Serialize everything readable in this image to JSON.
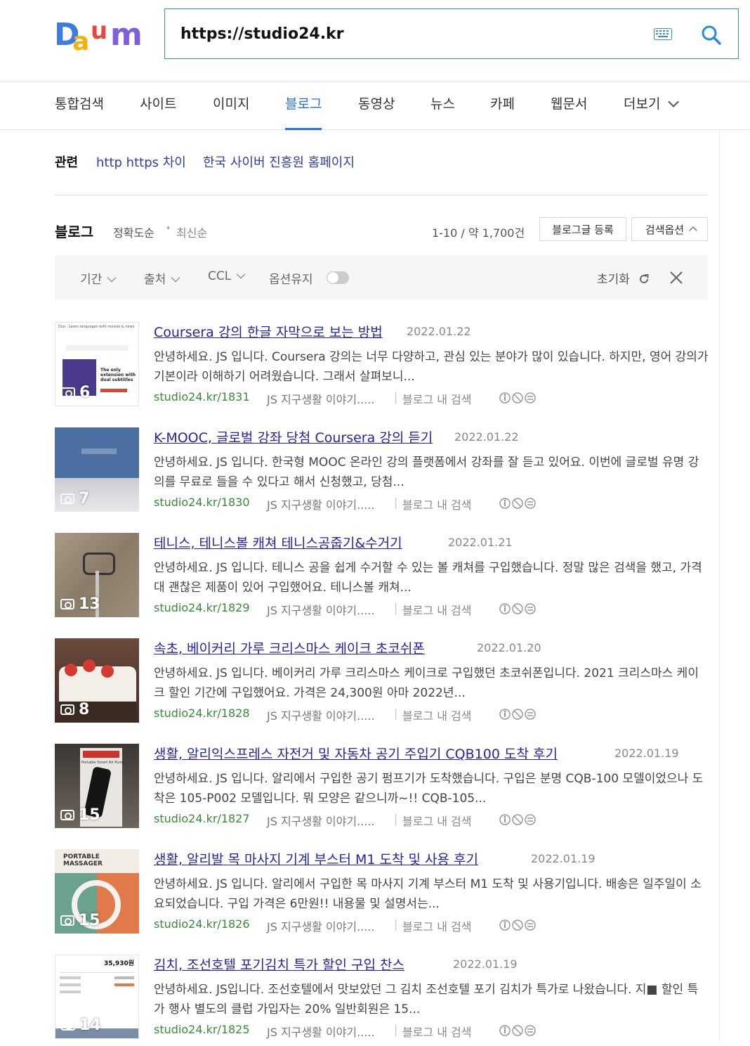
{
  "search": {
    "query": "https://studio24.kr"
  },
  "tabs": [
    "통합검색",
    "사이트",
    "이미지",
    "블로그",
    "동영상",
    "뉴스",
    "카페",
    "웹문서",
    "더보기"
  ],
  "related": {
    "label": "관련",
    "links": [
      "http https 차이",
      "한국 사이버 진흥원 홈페이지"
    ]
  },
  "blog_section": {
    "title": "블로그",
    "sort_accuracy": "정확도순",
    "sort_recent": "최신순",
    "count": "1-10 / 약 1,700건",
    "register_button": "블로그글 등록",
    "options_button": "검색옵션"
  },
  "filters": {
    "period": "기간",
    "source": "출처",
    "ccl": "CCL",
    "keep": "옵션유지",
    "reset": "초기화"
  },
  "results": [
    {
      "title": "Coursera 강의 한글 자막으로 보는 방법",
      "date": "2022.01.22",
      "desc": "안녕하세요. JS 입니다. Coursera 강의는 너무 다양하고, 관심 있는 분야가 많이 있습니다. 하지만, 영어 강의가 기본이라 이해하기 어려웠습니다. 그래서 살펴보니...",
      "url": "studio24.kr/1831",
      "source": "JS 지구생활 이야기.....",
      "blog_search": "블로그 내 검색",
      "photos": "6"
    },
    {
      "title": "K-MOOC, 글로벌 강좌 당첨 Coursera 강의 듣기",
      "date": "2022.01.22",
      "desc": "안녕하세요. JS 입니다. 한국형 MOOC 온라인 강의 플랫폼에서 강좌를 잘 듣고 있어요. 이번에 글로벌 유명 강의를 무료로 들을 수 있다고 해서 신청했고, 당첨...",
      "url": "studio24.kr/1830",
      "source": "JS 지구생활 이야기.....",
      "blog_search": "블로그 내 검색",
      "photos": "7"
    },
    {
      "title": "테니스, 테니스볼 캐쳐 테니스공줍기&수거기",
      "date": "2022.01.21",
      "desc": "안녕하세요. JS 입니다. 테니스 공을 쉽게 수거할 수 있는 볼 캐쳐를 구입했습니다. 정말 많은 검색을 했고, 가격대 괜찮은 제품이 있어 구입했어요. 테니스볼 캐쳐...",
      "url": "studio24.kr/1829",
      "source": "JS 지구생활 이야기.....",
      "blog_search": "블로그 내 검색",
      "photos": "13"
    },
    {
      "title": "속초, 베이커리 가루 크리스마스 케이크 초코쉬폰",
      "date": "2022.01.20",
      "desc": "안녕하세요. JS 입니다. 베이커리 가루 크리스마스 케이크로 구입했던 초코쉬폰입니다. 2021 크리스마스 케이크 할인 기간에 구입했어요. 가격은 24,300원 아마 2022년...",
      "url": "studio24.kr/1828",
      "source": "JS 지구생활 이야기.....",
      "blog_search": "블로그 내 검색",
      "photos": "8"
    },
    {
      "title": "생활, 알리익스프레스 자전거 및 자동차 공기 주입기 CQB100 도착 후기",
      "date": "2022.01.19",
      "desc": "안녕하세요. JS 입니다. 알리에서 구입한 공기 펌프기가 도착했습니다. 구입은 분명 CQB-100 모델이었으나 도착은 105-P002 모델입니다. 뭐 모양은 같으니까~!! CQB-105...",
      "url": "studio24.kr/1827",
      "source": "JS 지구생활 이야기.....",
      "blog_search": "블로그 내 검색",
      "photos": "15"
    },
    {
      "title": "생활, 알리발 목 마사지 기계 부스터 M1 도착 및 사용 후기",
      "date": "2022.01.19",
      "desc": "안녕하세요. JS 입니다. 알리에서 구입한 목 마사지 기계 부스터 M1 도착 및 사용기입니다. 배송은 일주일이 소요되었습니다. 구입 가격은 6만원!! 내용물 및 설명서는...",
      "url": "studio24.kr/1826",
      "source": "JS 지구생활 이야기.....",
      "blog_search": "블로그 내 검색",
      "photos": "15"
    },
    {
      "title": "김치, 조선호텔 포기김치 특가 할인 구입 찬스",
      "date": "2022.01.19",
      "desc": "안녕하세요. JS입니다. 조선호텔에서 맛보았던 그 김치 조선호텔 포기 김치가 특가로 나왔습니다. 지■ 할인 특가 행사 별도의 클럽 가입자는 20% 일반회원은 15...",
      "url": "studio24.kr/1825",
      "source": "JS 지구생활 이야기.....",
      "blog_search": "블로그 내 검색",
      "photos": "14"
    }
  ],
  "thumb_texts": {
    "t0_header": "Duo - Learn languages with movies & news",
    "t0_caption": "The only extension with dual subtitles",
    "t4_label": "Portable Smart Air Pump",
    "t5_line1": "PORTABLE",
    "t5_line2": "MASSAGER",
    "t6_total": "35,930원"
  }
}
